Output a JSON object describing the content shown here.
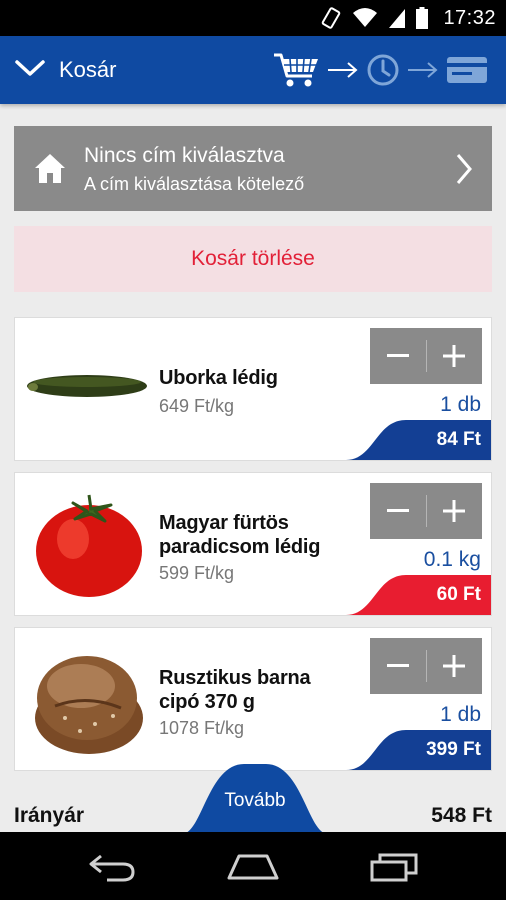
{
  "status_bar": {
    "time": "17:32"
  },
  "app_bar": {
    "title": "Kosár"
  },
  "address": {
    "line1": "Nincs cím kiválasztva",
    "line2": "A cím kiválasztása kötelező"
  },
  "clear_cart": {
    "label": "Kosár törlése"
  },
  "items": [
    {
      "name_line1": "Uborka lédig",
      "name_line2": "",
      "price": "649 Ft/kg",
      "quantity": "1 db",
      "total": "84 Ft",
      "tab_color": "#133f94"
    },
    {
      "name_line1": "Magyar fürtös",
      "name_line2": "paradicsom lédig",
      "price": "599 Ft/kg",
      "quantity": "0.1 kg",
      "total": "60 Ft",
      "tab_color": "#e81d30"
    },
    {
      "name_line1": "Rusztikus barna",
      "name_line2": "cipó 370 g",
      "price": "1078 Ft/kg",
      "quantity": "1 db",
      "total": "399 Ft",
      "tab_color": "#133f94"
    }
  ],
  "footer": {
    "label": "Irányár",
    "total": "548 Ft",
    "next_label": "Tovább"
  },
  "colors": {
    "primary": "#0f4aa2",
    "accent_red": "#e22138",
    "gray": "#8a8a8a"
  },
  "icons": {
    "stepper_minus": "minus-icon",
    "stepper_plus": "plus-icon",
    "home": "home-icon",
    "chevron": "chevron-right-icon"
  }
}
